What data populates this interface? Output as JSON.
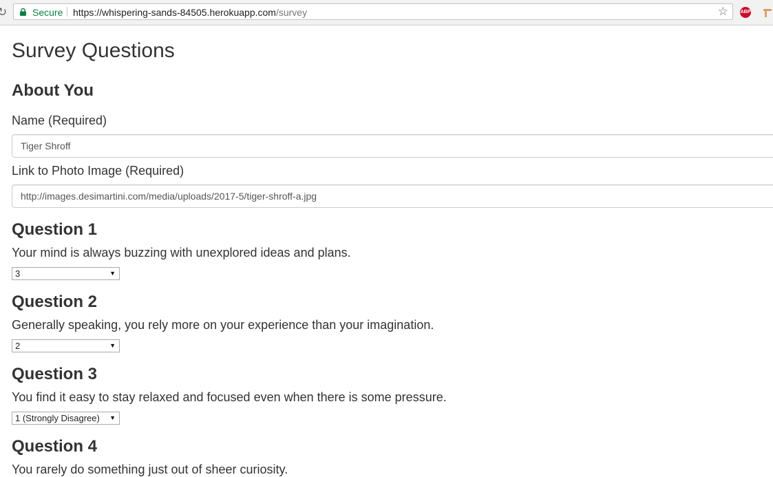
{
  "browser": {
    "secure_label": "Secure",
    "url_main": "https://whispering-sands-84505.herokuapp.com",
    "url_path": "/survey",
    "abp_label": "ABP"
  },
  "page": {
    "title": "Survey Questions"
  },
  "about": {
    "heading": "About You",
    "name_label": "Name (Required)",
    "name_value": "Tiger Shroff",
    "photo_label": "Link to Photo Image (Required)",
    "photo_value": "http://images.desimartini.com/media/uploads/2017-5/tiger-shroff-a.jpg"
  },
  "questions": [
    {
      "heading": "Question 1",
      "text": "Your mind is always buzzing with unexplored ideas and plans.",
      "selected": "3"
    },
    {
      "heading": "Question 2",
      "text": "Generally speaking, you rely more on your experience than your imagination.",
      "selected": "2"
    },
    {
      "heading": "Question 3",
      "text": "You find it easy to stay relaxed and focused even when there is some pressure.",
      "selected": "1 (Strongly Disagree)"
    },
    {
      "heading": "Question 4",
      "text": "You rarely do something just out of sheer curiosity."
    }
  ],
  "colors": {
    "secure_green": "#0b8043",
    "text": "#333333",
    "abp_red": "#c70d2c"
  }
}
